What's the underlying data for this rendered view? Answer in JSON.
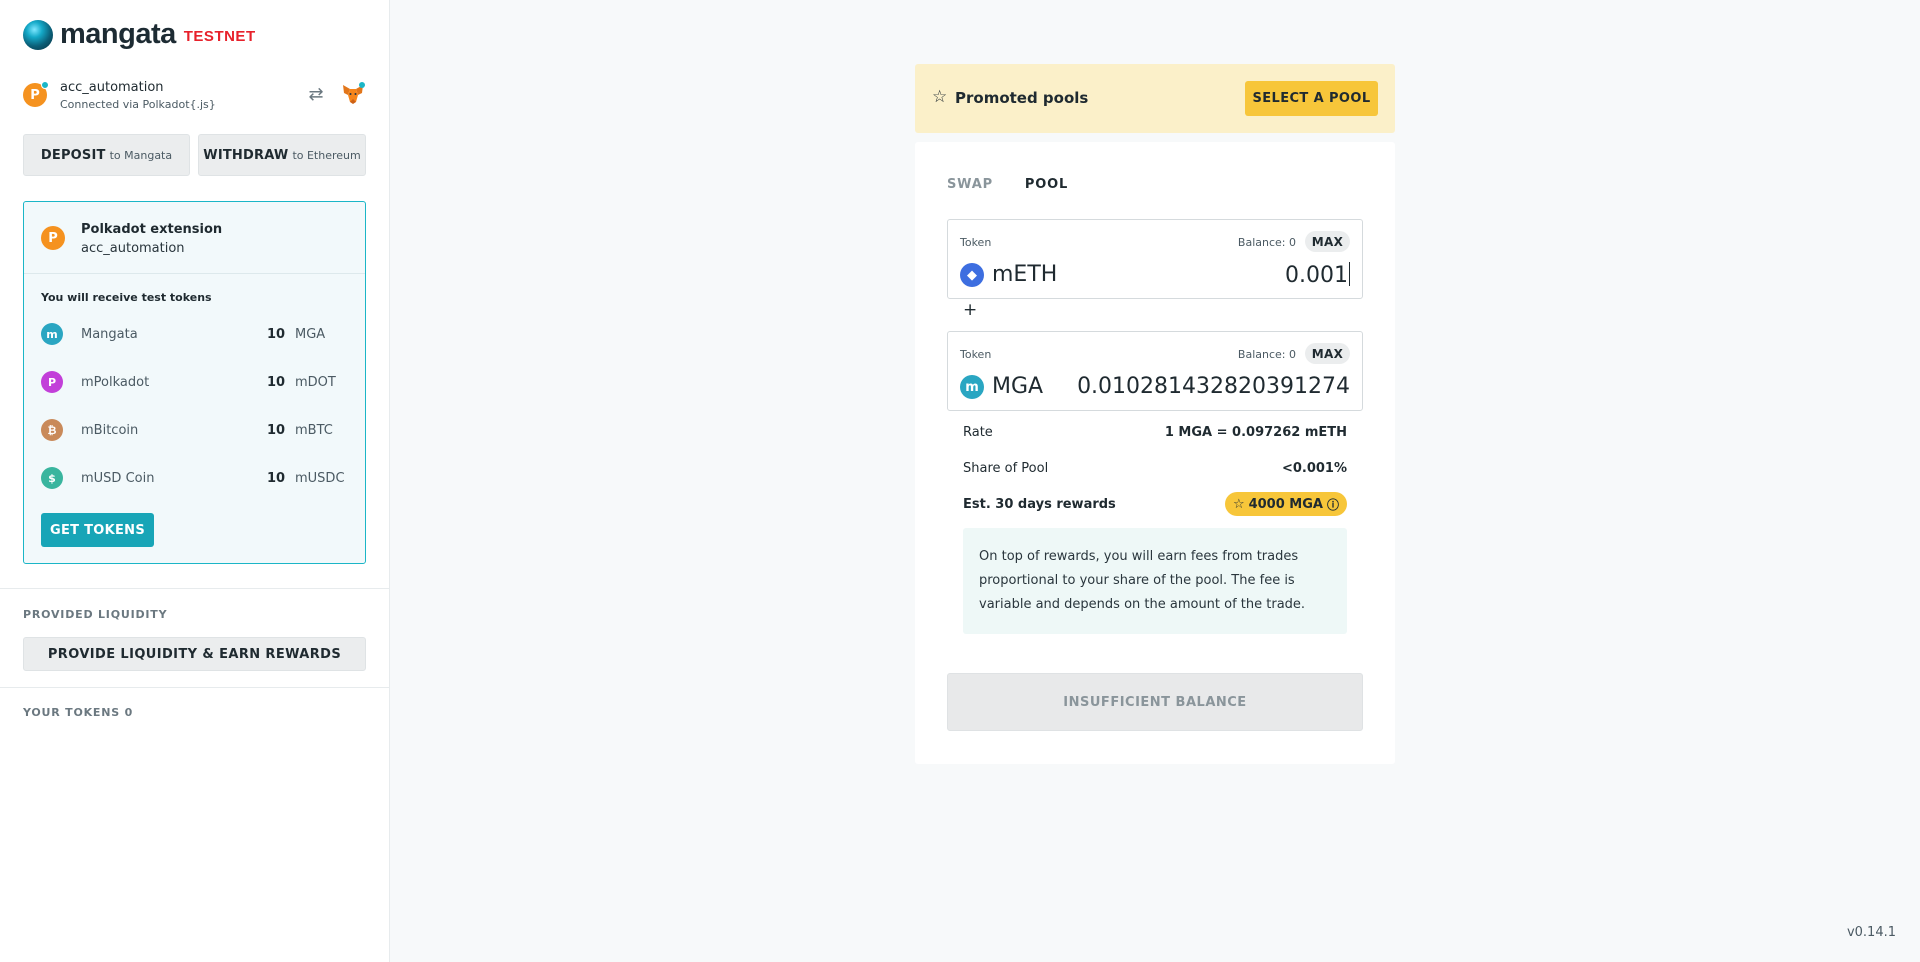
{
  "brand": {
    "name": "mangata",
    "badge": "TESTNET"
  },
  "account": {
    "name": "acc_automation",
    "connection": "Connected via Polkadot{.js}"
  },
  "actions": {
    "deposit_label": "DEPOSIT",
    "deposit_sub": "to Mangata",
    "withdraw_label": "WITHDRAW",
    "withdraw_sub": "to Ethereum"
  },
  "extension": {
    "title": "Polkadot extension",
    "account": "acc_automation",
    "receive_text": "You will receive test tokens",
    "tokens": [
      {
        "name": "Mangata",
        "amount": "10",
        "symbol": "MGA",
        "color": "#2aa6c2"
      },
      {
        "name": "mPolkadot",
        "amount": "10",
        "symbol": "mDOT",
        "color": "#c23fd9"
      },
      {
        "name": "mBitcoin",
        "amount": "10",
        "symbol": "mBTC",
        "color": "#c98a5a"
      },
      {
        "name": "mUSD Coin",
        "amount": "10",
        "symbol": "mUSDC",
        "color": "#39b59e"
      }
    ],
    "get_tokens_label": "GET TOKENS"
  },
  "liquidity": {
    "section_label": "PROVIDED LIQUIDITY",
    "provide_label": "PROVIDE LIQUIDITY & EARN REWARDS"
  },
  "your_tokens": {
    "label": "YOUR TOKENS",
    "count": "0"
  },
  "promo": {
    "title": "Promoted pools",
    "button": "SELECT A POOL"
  },
  "tabs": [
    {
      "label": "SWAP",
      "active": false
    },
    {
      "label": "POOL",
      "active": true
    }
  ],
  "pool": {
    "first": {
      "label": "Token",
      "balance": "Balance: 0",
      "max": "MAX",
      "symbol": "mETH",
      "value": "0.001"
    },
    "plus": "+",
    "second": {
      "label": "Token",
      "balance": "Balance: 0",
      "max": "MAX",
      "symbol": "MGA",
      "value": "0.010281432820391274"
    },
    "rate_label": "Rate",
    "rate_value": "1 MGA = 0.097262 mETH",
    "share_label": "Share of Pool",
    "share_value": "<0.001%",
    "rewards_label": "Est. 30 days rewards",
    "rewards_value": "4000 MGA",
    "fee_note": "On top of rewards, you will earn fees from trades proportional to your share of the pool. The fee is variable and depends on the amount of the trade.",
    "submit_label": "INSUFFICIENT BALANCE"
  },
  "version": "v0.14.1"
}
